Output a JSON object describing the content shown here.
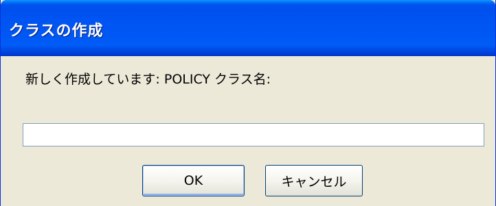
{
  "dialog": {
    "title": "クラスの作成",
    "prompt": "新しく作成しています: POLICY クラス名:",
    "input_value": "",
    "ok_label": "OK",
    "cancel_label": "キャンセル"
  },
  "colors": {
    "titlebar": "#0055ea",
    "dialog_background": "#ece9d8",
    "button_border": "#003c74"
  }
}
